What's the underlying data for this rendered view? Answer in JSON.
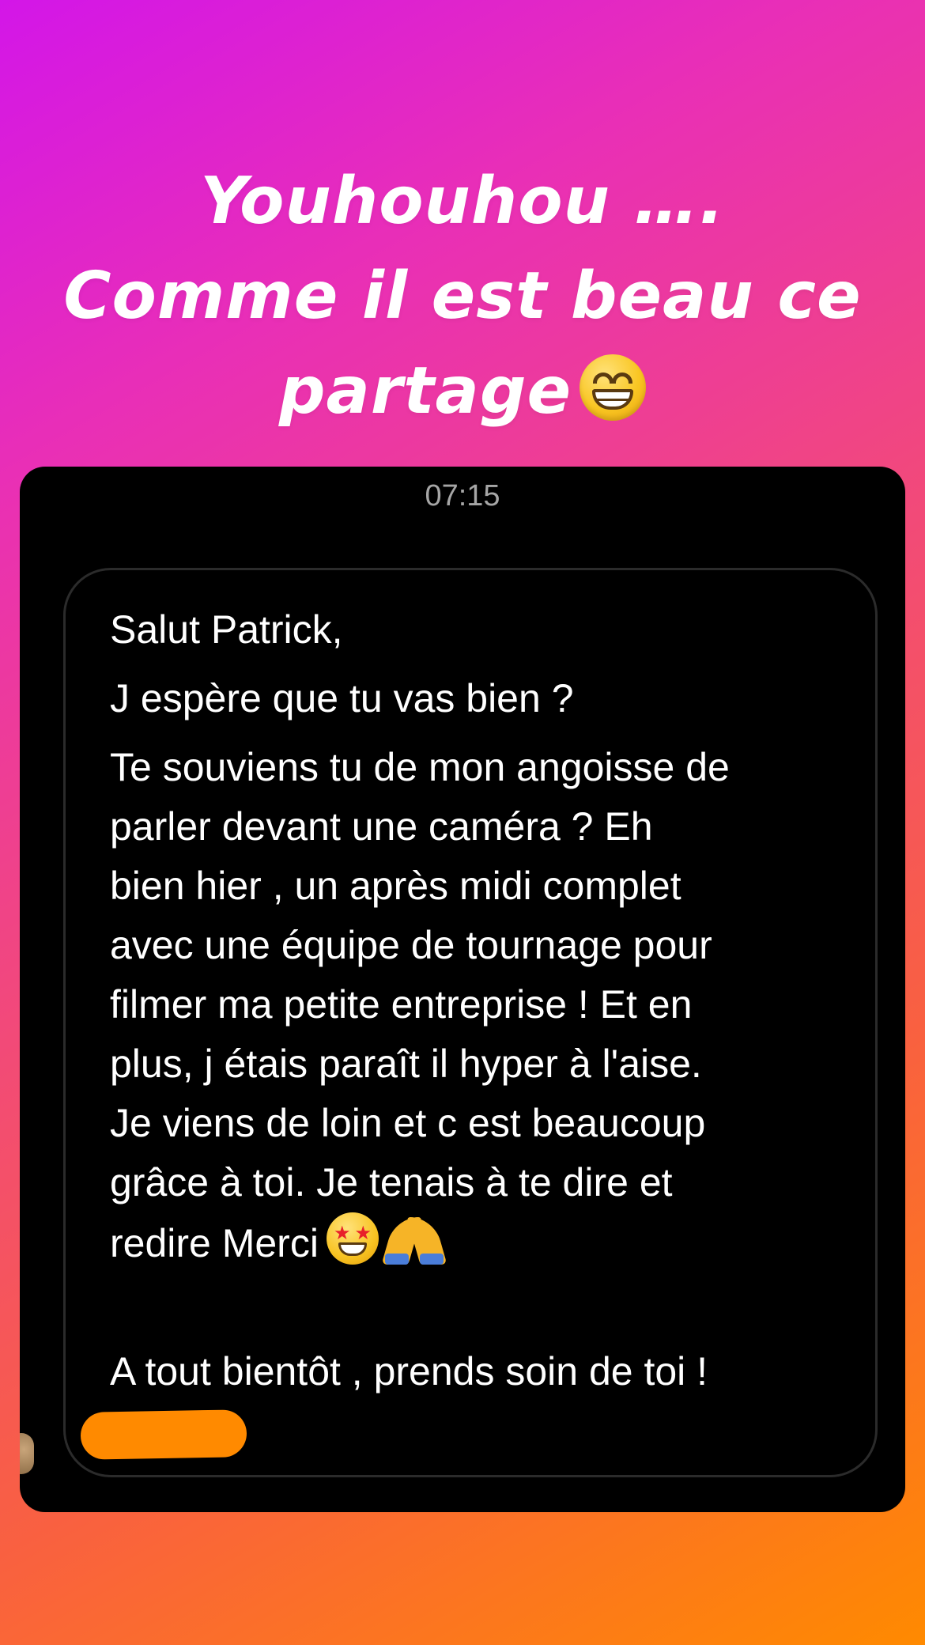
{
  "story": {
    "caption_line1": "Youhouhou ….",
    "caption_line2": "Comme il est beau ce",
    "caption_line3": "partage",
    "caption_emoji": "grinning-face-with-smiling-eyes",
    "background_colors": [
      "#d316e8",
      "#f24a78",
      "#ff8a00"
    ]
  },
  "chat": {
    "timestamp": "07:15",
    "message": {
      "greeting": "Salut Patrick,",
      "line2": "J espère que tu vas bien ?",
      "body": [
        "Te souviens tu de mon angoisse de",
        "parler devant une caméra ? Eh",
        "bien hier , un après midi complet",
        "avec une équipe de tournage pour",
        "filmer ma petite entreprise ! Et en",
        "plus, j étais paraît il hyper à l'aise.",
        "Je viens de loin et c est beaucoup",
        "grâce à toi. Je tenais à te dire et"
      ],
      "last_line_text": "redire Merci",
      "last_line_emojis": [
        "star-struck",
        "folded-hands"
      ],
      "signoff": "A tout bientôt , prends soin de toi !"
    },
    "redaction_color": "#ff8a00"
  }
}
